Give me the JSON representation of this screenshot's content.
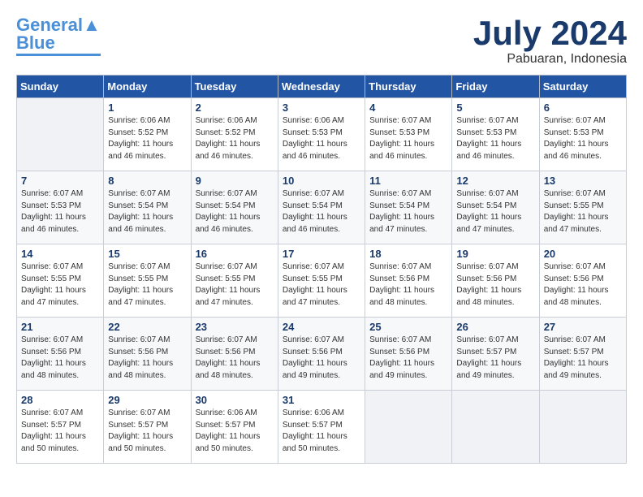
{
  "logo": {
    "line1": "General",
    "line2": "Blue"
  },
  "title": "July 2024",
  "location": "Pabuaran, Indonesia",
  "days_header": [
    "Sunday",
    "Monday",
    "Tuesday",
    "Wednesday",
    "Thursday",
    "Friday",
    "Saturday"
  ],
  "weeks": [
    [
      {
        "num": "",
        "empty": true
      },
      {
        "num": "1",
        "sunrise": "6:06 AM",
        "sunset": "5:52 PM",
        "daylight": "11 hours and 46 minutes."
      },
      {
        "num": "2",
        "sunrise": "6:06 AM",
        "sunset": "5:52 PM",
        "daylight": "11 hours and 46 minutes."
      },
      {
        "num": "3",
        "sunrise": "6:06 AM",
        "sunset": "5:53 PM",
        "daylight": "11 hours and 46 minutes."
      },
      {
        "num": "4",
        "sunrise": "6:07 AM",
        "sunset": "5:53 PM",
        "daylight": "11 hours and 46 minutes."
      },
      {
        "num": "5",
        "sunrise": "6:07 AM",
        "sunset": "5:53 PM",
        "daylight": "11 hours and 46 minutes."
      },
      {
        "num": "6",
        "sunrise": "6:07 AM",
        "sunset": "5:53 PM",
        "daylight": "11 hours and 46 minutes."
      }
    ],
    [
      {
        "num": "7",
        "sunrise": "6:07 AM",
        "sunset": "5:53 PM",
        "daylight": "11 hours and 46 minutes."
      },
      {
        "num": "8",
        "sunrise": "6:07 AM",
        "sunset": "5:54 PM",
        "daylight": "11 hours and 46 minutes."
      },
      {
        "num": "9",
        "sunrise": "6:07 AM",
        "sunset": "5:54 PM",
        "daylight": "11 hours and 46 minutes."
      },
      {
        "num": "10",
        "sunrise": "6:07 AM",
        "sunset": "5:54 PM",
        "daylight": "11 hours and 46 minutes."
      },
      {
        "num": "11",
        "sunrise": "6:07 AM",
        "sunset": "5:54 PM",
        "daylight": "11 hours and 47 minutes."
      },
      {
        "num": "12",
        "sunrise": "6:07 AM",
        "sunset": "5:54 PM",
        "daylight": "11 hours and 47 minutes."
      },
      {
        "num": "13",
        "sunrise": "6:07 AM",
        "sunset": "5:55 PM",
        "daylight": "11 hours and 47 minutes."
      }
    ],
    [
      {
        "num": "14",
        "sunrise": "6:07 AM",
        "sunset": "5:55 PM",
        "daylight": "11 hours and 47 minutes."
      },
      {
        "num": "15",
        "sunrise": "6:07 AM",
        "sunset": "5:55 PM",
        "daylight": "11 hours and 47 minutes."
      },
      {
        "num": "16",
        "sunrise": "6:07 AM",
        "sunset": "5:55 PM",
        "daylight": "11 hours and 47 minutes."
      },
      {
        "num": "17",
        "sunrise": "6:07 AM",
        "sunset": "5:55 PM",
        "daylight": "11 hours and 47 minutes."
      },
      {
        "num": "18",
        "sunrise": "6:07 AM",
        "sunset": "5:56 PM",
        "daylight": "11 hours and 48 minutes."
      },
      {
        "num": "19",
        "sunrise": "6:07 AM",
        "sunset": "5:56 PM",
        "daylight": "11 hours and 48 minutes."
      },
      {
        "num": "20",
        "sunrise": "6:07 AM",
        "sunset": "5:56 PM",
        "daylight": "11 hours and 48 minutes."
      }
    ],
    [
      {
        "num": "21",
        "sunrise": "6:07 AM",
        "sunset": "5:56 PM",
        "daylight": "11 hours and 48 minutes."
      },
      {
        "num": "22",
        "sunrise": "6:07 AM",
        "sunset": "5:56 PM",
        "daylight": "11 hours and 48 minutes."
      },
      {
        "num": "23",
        "sunrise": "6:07 AM",
        "sunset": "5:56 PM",
        "daylight": "11 hours and 48 minutes."
      },
      {
        "num": "24",
        "sunrise": "6:07 AM",
        "sunset": "5:56 PM",
        "daylight": "11 hours and 49 minutes."
      },
      {
        "num": "25",
        "sunrise": "6:07 AM",
        "sunset": "5:56 PM",
        "daylight": "11 hours and 49 minutes."
      },
      {
        "num": "26",
        "sunrise": "6:07 AM",
        "sunset": "5:57 PM",
        "daylight": "11 hours and 49 minutes."
      },
      {
        "num": "27",
        "sunrise": "6:07 AM",
        "sunset": "5:57 PM",
        "daylight": "11 hours and 49 minutes."
      }
    ],
    [
      {
        "num": "28",
        "sunrise": "6:07 AM",
        "sunset": "5:57 PM",
        "daylight": "11 hours and 50 minutes."
      },
      {
        "num": "29",
        "sunrise": "6:07 AM",
        "sunset": "5:57 PM",
        "daylight": "11 hours and 50 minutes."
      },
      {
        "num": "30",
        "sunrise": "6:06 AM",
        "sunset": "5:57 PM",
        "daylight": "11 hours and 50 minutes."
      },
      {
        "num": "31",
        "sunrise": "6:06 AM",
        "sunset": "5:57 PM",
        "daylight": "11 hours and 50 minutes."
      },
      {
        "num": "",
        "empty": true
      },
      {
        "num": "",
        "empty": true
      },
      {
        "num": "",
        "empty": true
      }
    ]
  ]
}
